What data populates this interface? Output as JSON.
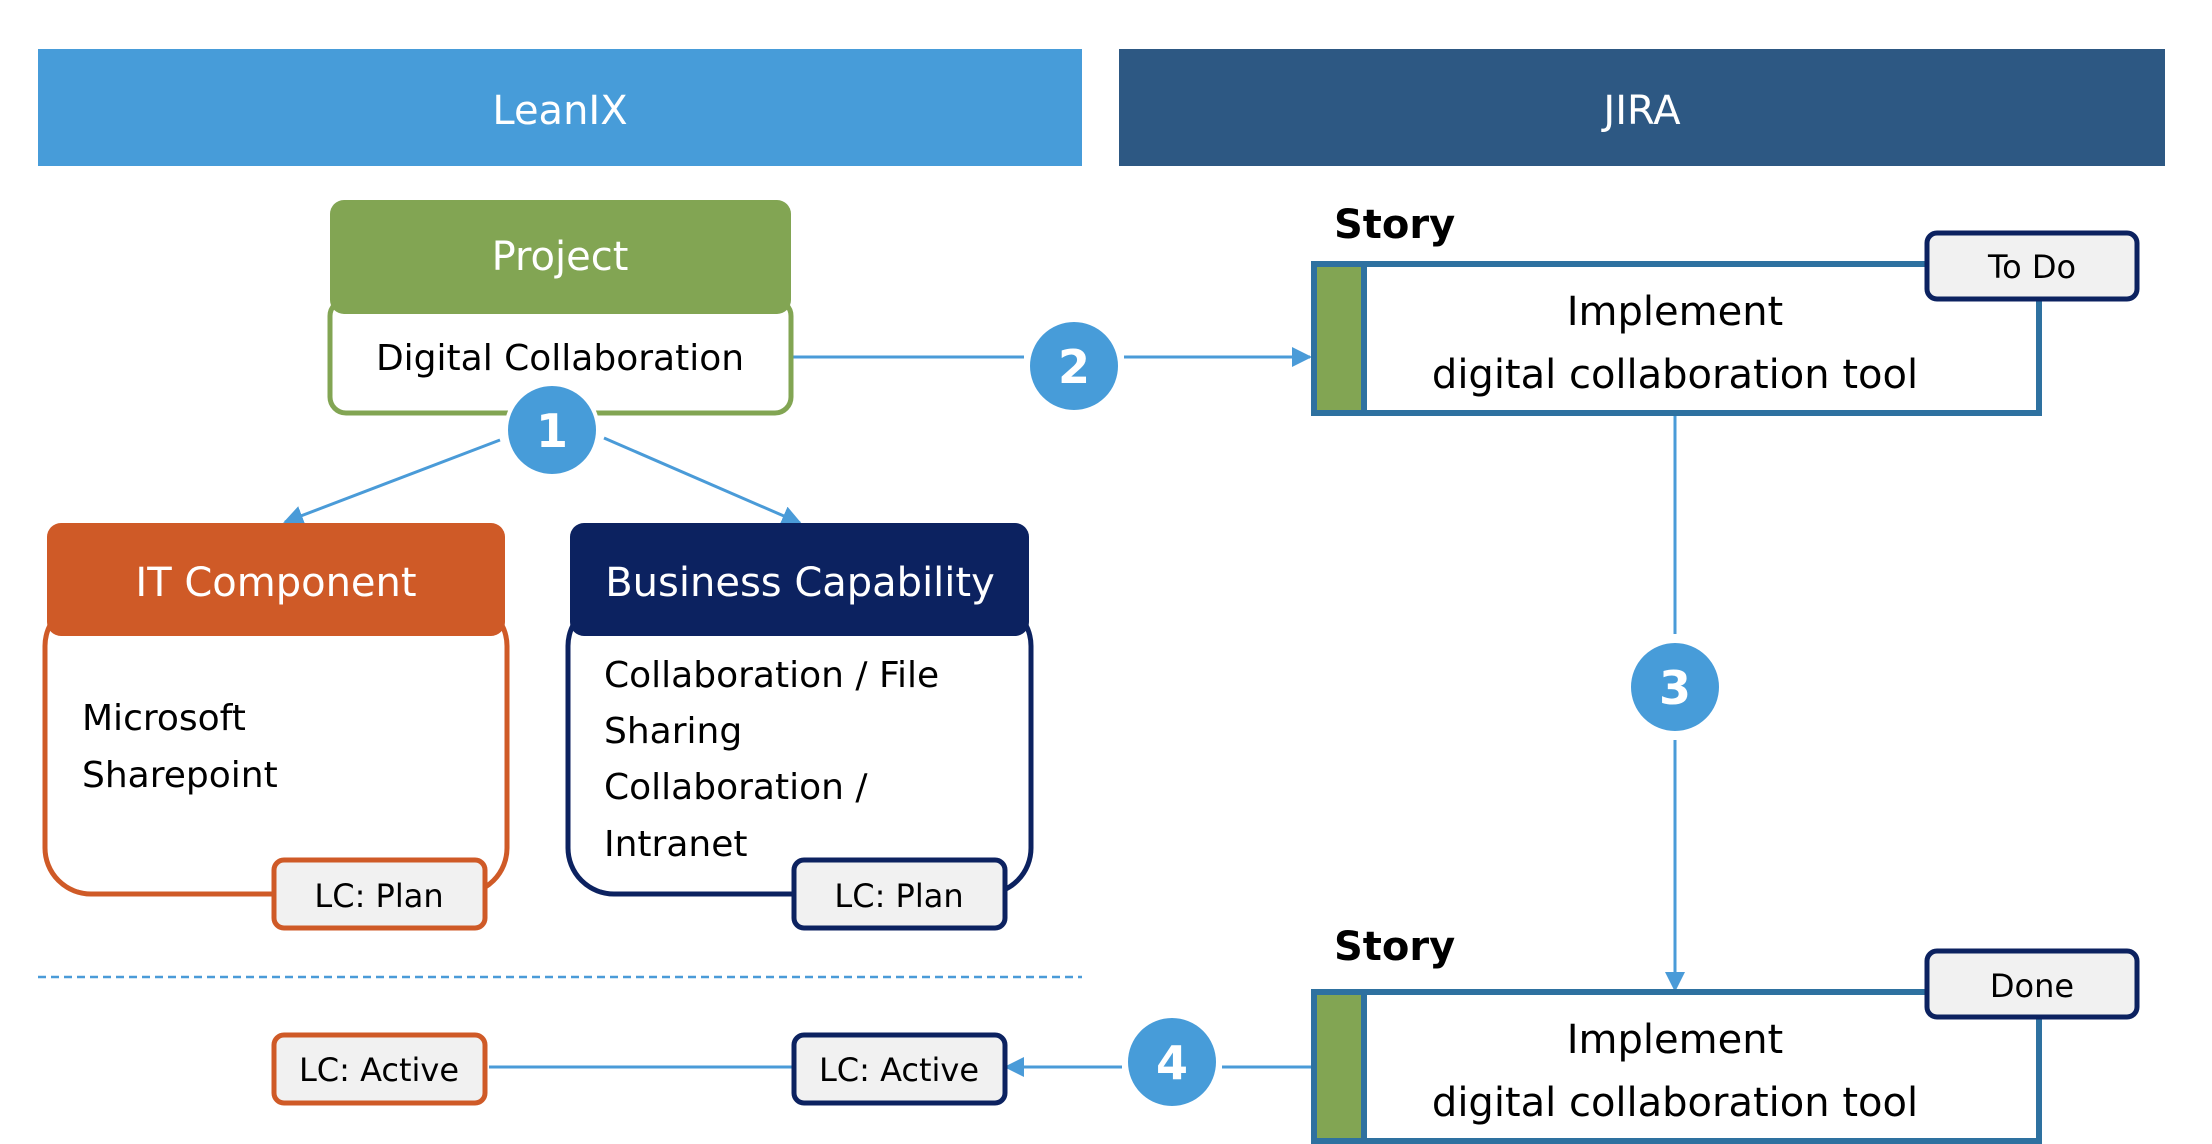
{
  "headers": {
    "left": {
      "label": "LeanIX",
      "color": "#479cd9"
    },
    "right": {
      "label": "JIRA",
      "color": "#2d5883"
    }
  },
  "project": {
    "title": "Project",
    "name": "Digital Collaboration",
    "color": "#82a553"
  },
  "it_component": {
    "title": "IT Component",
    "lines": [
      "Microsoft",
      "Sharepoint"
    ],
    "lifecycle": "LC: Plan",
    "lifecycle_after": "LC: Active",
    "color": "#cf5a27"
  },
  "business_capability": {
    "title": "Business Capability",
    "lines": [
      "Collaboration / File",
      "Sharing",
      "Collaboration /",
      "Intranet"
    ],
    "lifecycle": "LC: Plan",
    "lifecycle_after": "LC: Active",
    "color": "#0c2260"
  },
  "stories": [
    {
      "label": "Story",
      "lines": [
        "Implement",
        "digital collaboration tool"
      ],
      "status": "To Do"
    },
    {
      "label": "Story",
      "lines": [
        "Implement",
        "digital collaboration tool"
      ],
      "status": "Done"
    }
  ],
  "story_style": {
    "border": "#2e71a0",
    "epic_color": "#82a553",
    "status_border": "#0c2260"
  },
  "steps": [
    "1",
    "2",
    "3",
    "4"
  ],
  "step_color": "#479cd9"
}
